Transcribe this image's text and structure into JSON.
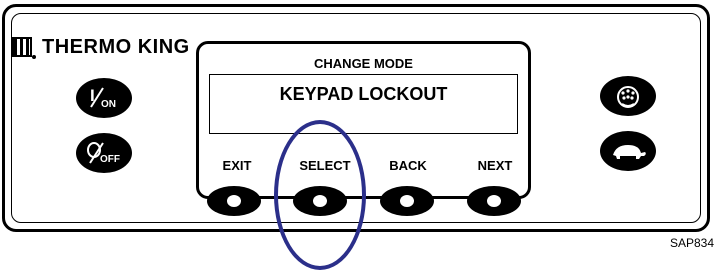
{
  "brand": {
    "name": "THERMO KING"
  },
  "display": {
    "mode_title": "CHANGE MODE",
    "lcd_text": "KEYPAD LOCKOUT"
  },
  "left_keys": [
    {
      "label": "I/ON",
      "icon": "power-on-icon"
    },
    {
      "label": "O/OFF",
      "icon": "power-off-icon"
    }
  ],
  "right_keys": [
    {
      "icon": "gauges-icon"
    },
    {
      "icon": "turtle-icon"
    }
  ],
  "soft_keys": [
    {
      "label": "EXIT"
    },
    {
      "label": "SELECT",
      "highlighted": true
    },
    {
      "label": "BACK"
    },
    {
      "label": "NEXT"
    }
  ],
  "highlight_color": "#2b2f8a",
  "figure_id": "SAP834"
}
